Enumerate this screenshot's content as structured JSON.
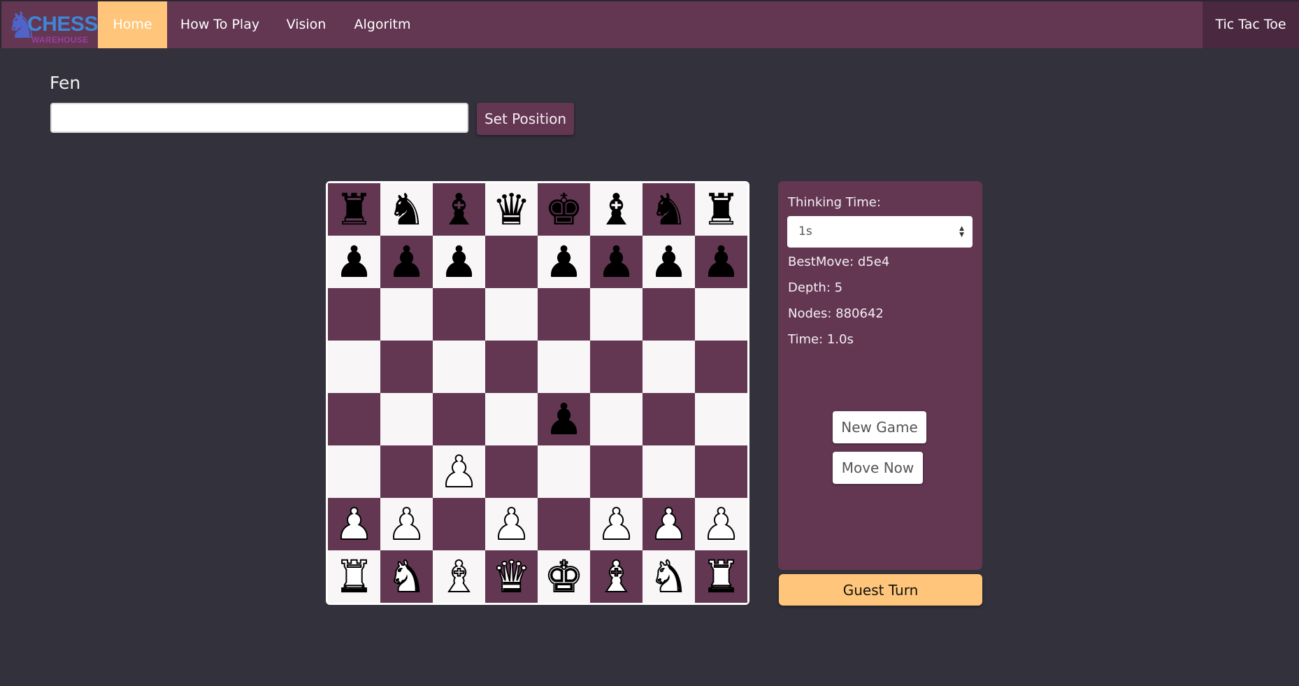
{
  "nav": {
    "brand_line1": "CHESS",
    "brand_line2": "WAREHOUSE",
    "items": [
      {
        "label": "Home",
        "active": true
      },
      {
        "label": "How To Play",
        "active": false
      },
      {
        "label": "Vision",
        "active": false
      },
      {
        "label": "Algoritm",
        "active": false
      }
    ],
    "right_item": "Tic Tac Toe"
  },
  "fen": {
    "label": "Fen",
    "value": "",
    "set_button": "Set Position"
  },
  "board": {
    "rows": [
      [
        "br",
        "bn",
        "bb",
        "bq",
        "bk",
        "bb",
        "bn",
        "br"
      ],
      [
        "bp",
        "bp",
        "bp",
        "",
        "bp",
        "bp",
        "bp",
        "bp"
      ],
      [
        "",
        "",
        "",
        "",
        "",
        "",
        "",
        ""
      ],
      [
        "",
        "",
        "",
        "",
        "",
        "",
        "",
        ""
      ],
      [
        "",
        "",
        "",
        "",
        "bp",
        "",
        "",
        ""
      ],
      [
        "",
        "",
        "wp",
        "",
        "",
        "",
        "",
        ""
      ],
      [
        "wp",
        "wp",
        "",
        "wp",
        "",
        "wp",
        "wp",
        "wp"
      ],
      [
        "wr",
        "wn",
        "wb",
        "wq",
        "wk",
        "wb",
        "wn",
        "wr"
      ]
    ],
    "light_color": "#f9f6f8",
    "dark_color": "#633752"
  },
  "engine": {
    "thinking_time_label": "Thinking Time:",
    "thinking_time_value": "1s",
    "best_move": "BestMove: d5e4",
    "depth": "Depth: 5",
    "nodes": "Nodes: 880642",
    "time": "Time: 1.0s",
    "new_game": "New Game",
    "move_now": "Move Now",
    "turn": "Guest Turn"
  },
  "colors": {
    "accent": "#633752",
    "highlight": "#ffc57a",
    "background": "#33313b"
  }
}
